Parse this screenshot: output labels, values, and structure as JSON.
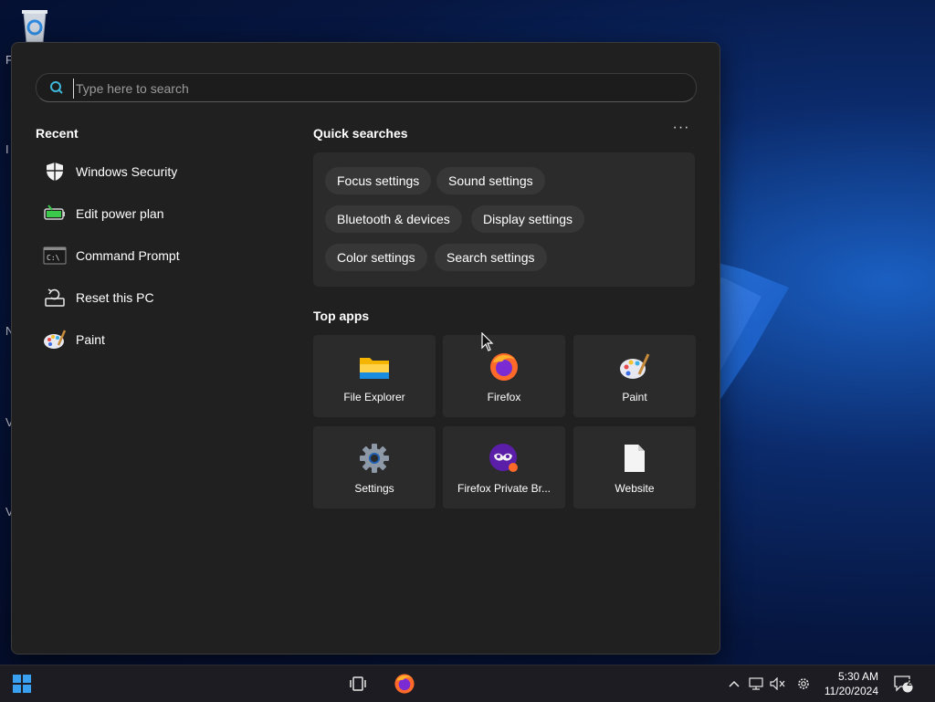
{
  "desktop": {
    "icon_letters": [
      "F",
      "I",
      "N",
      "V",
      "V"
    ]
  },
  "search": {
    "placeholder": "Type here to search"
  },
  "recent": {
    "title": "Recent",
    "items": [
      {
        "label": "Windows Security",
        "icon": "shield-icon"
      },
      {
        "label": "Edit power plan",
        "icon": "battery-icon"
      },
      {
        "label": "Command Prompt",
        "icon": "command-prompt-icon"
      },
      {
        "label": "Reset this PC",
        "icon": "reset-pc-icon"
      },
      {
        "label": "Paint",
        "icon": "paint-palette-icon"
      }
    ]
  },
  "quick_searches": {
    "title": "Quick searches",
    "more_label": "···",
    "chips": [
      "Focus settings",
      "Sound settings",
      "Bluetooth & devices",
      "Display settings",
      "Color settings",
      "Search settings"
    ]
  },
  "top_apps": {
    "title": "Top apps",
    "apps": [
      {
        "label": "File Explorer",
        "icon": "file-explorer-icon"
      },
      {
        "label": "Firefox",
        "icon": "firefox-icon"
      },
      {
        "label": "Paint",
        "icon": "paint-palette-icon"
      },
      {
        "label": "Settings",
        "icon": "settings-gear-icon"
      },
      {
        "label": "Firefox Private Br...",
        "icon": "firefox-private-icon"
      },
      {
        "label": "Website",
        "icon": "document-icon"
      }
    ]
  },
  "taskbar": {
    "time": "5:30 AM",
    "date": "11/20/2024",
    "notification_count": "2",
    "icons": [
      "start-icon",
      "task-view-icon",
      "firefox-icon",
      "chevron-up-icon",
      "network-icon",
      "volume-muted-icon",
      "settings-gear-icon",
      "notifications-icon"
    ]
  },
  "colors": {
    "panel_bg": "#202020",
    "tile_bg": "#2b2b2b",
    "chip_bg": "#373737",
    "accent": "#0078d4",
    "taskbar_bg": "#1c1c22"
  }
}
